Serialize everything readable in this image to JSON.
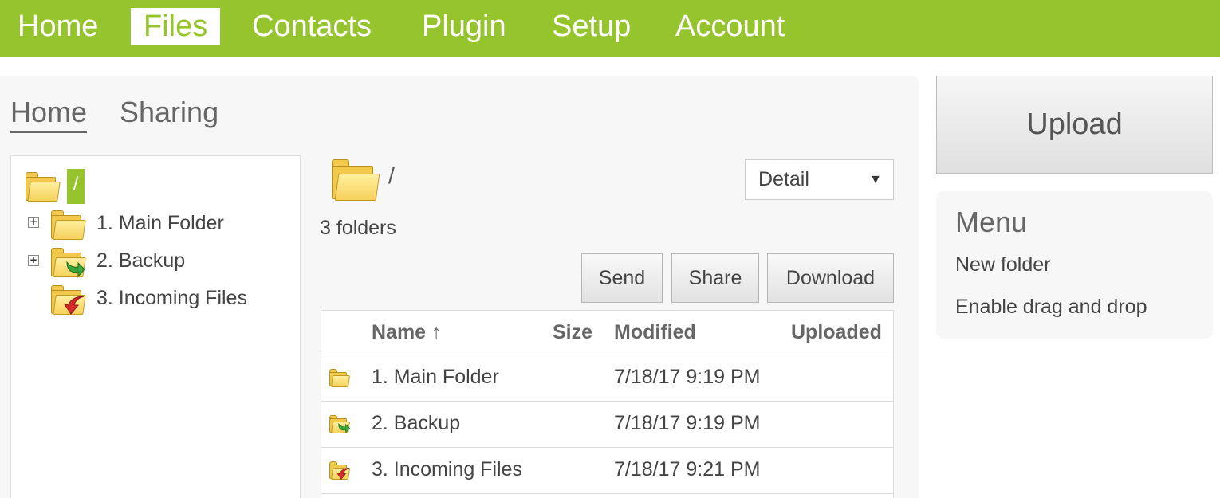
{
  "nav": {
    "items": [
      {
        "label": "Home"
      },
      {
        "label": "Files"
      },
      {
        "label": "Contacts"
      },
      {
        "label": "Plugin"
      },
      {
        "label": "Setup"
      },
      {
        "label": "Account"
      }
    ],
    "active": "Files"
  },
  "subtabs": {
    "home": "Home",
    "sharing": "Sharing"
  },
  "tree": {
    "root_label": "/",
    "items": [
      {
        "label": "1. Main Folder",
        "icon": "folder-icon"
      },
      {
        "label": "2. Backup",
        "icon": "backup-folder-icon"
      },
      {
        "label": "3. Incoming Files",
        "icon": "incoming-folder-icon"
      }
    ]
  },
  "content": {
    "path": "/",
    "folder_count": "3 folders",
    "view_select": "Detail",
    "buttons": {
      "send": "Send",
      "share": "Share",
      "download": "Download"
    },
    "table": {
      "headers": {
        "name": "Name ↑",
        "size": "Size",
        "modified": "Modified",
        "uploaded": "Uploaded"
      },
      "rows": [
        {
          "name": "1. Main Folder",
          "size": "",
          "modified": "7/18/17 9:19 PM",
          "uploaded": ""
        },
        {
          "name": "2. Backup",
          "size": "",
          "modified": "7/18/17 9:19 PM",
          "uploaded": ""
        },
        {
          "name": "3. Incoming Files",
          "size": "",
          "modified": "7/18/17 9:21 PM",
          "uploaded": ""
        }
      ]
    }
  },
  "sidebar": {
    "upload_label": "Upload",
    "menu_title": "Menu",
    "menu_items": [
      {
        "label": "New folder"
      },
      {
        "label": "Enable drag and drop"
      }
    ]
  },
  "colors": {
    "accent": "#95c42d",
    "folder": "#f2c94c",
    "backup_arrow": "#3aa53a",
    "incoming_arrow": "#d42a2a"
  }
}
